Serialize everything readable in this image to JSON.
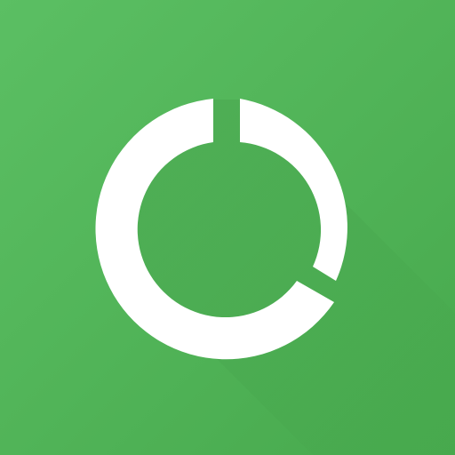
{
  "icon": {
    "name": "segmented-ring-progress-icon",
    "colors": {
      "background": "#4CAF50",
      "background_gradient_start": "#5BBF63",
      "background_gradient_end": "#47A94D",
      "shadow": "#2E7D32",
      "ring": "#FFFFFF"
    },
    "segments": [
      {
        "name": "major-segment",
        "fraction": 0.75
      },
      {
        "name": "minor-segment",
        "fraction": 0.22
      }
    ]
  }
}
